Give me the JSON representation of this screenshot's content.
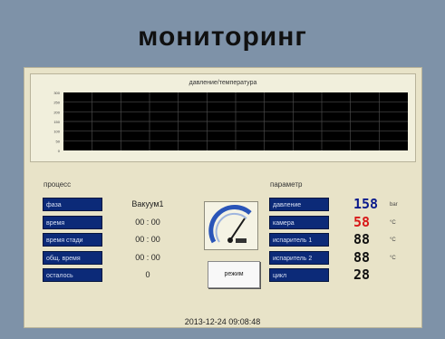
{
  "header": {
    "title": "мониторинг"
  },
  "chart": {
    "title": "давление/температура",
    "y_ticks": [
      "300",
      "250",
      "200",
      "150",
      "100",
      "50",
      "0"
    ]
  },
  "chart_data": {
    "type": "line",
    "title": "давление/температура",
    "y_tick_labels": [
      "300",
      "250",
      "200",
      "150",
      "100",
      "50",
      "0"
    ],
    "grid": true,
    "series": []
  },
  "process": {
    "label": "процесс",
    "rows": [
      {
        "label": "фаза",
        "value": "Вакуум1"
      },
      {
        "label": "время",
        "value": "00 : 00"
      },
      {
        "label": "время стади",
        "value": "00 : 00"
      },
      {
        "label": "общ. время",
        "value": "00 : 00"
      },
      {
        "label": "осталось",
        "value": "0"
      }
    ]
  },
  "params": {
    "label": "параметр",
    "rows": [
      {
        "label": "давление",
        "digits": "158",
        "unit": "bar",
        "color": "#0a1a8c"
      },
      {
        "label": "камера",
        "digits": "58",
        "unit": "°C",
        "color": "#d81818"
      },
      {
        "label": "испаритель 1",
        "digits": "88",
        "unit": "°C",
        "color": "#101010"
      },
      {
        "label": "испаритель 2",
        "digits": "88",
        "unit": "°C",
        "color": "#101010"
      },
      {
        "label": "цикл",
        "digits": "28",
        "unit": "",
        "color": "#101010"
      }
    ]
  },
  "mode_button": {
    "label": "режим"
  },
  "timestamp": "2013-12-24  09:08:48"
}
